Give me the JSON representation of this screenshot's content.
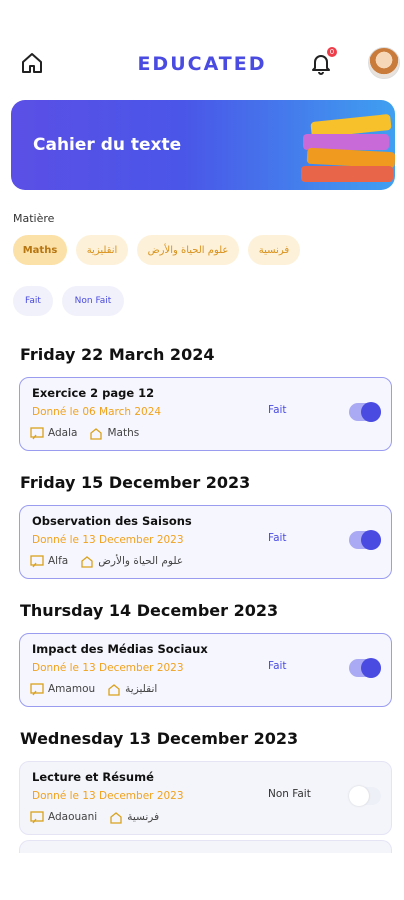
{
  "app": {
    "logo": "EDUCATED",
    "notification_count": "0"
  },
  "banner": {
    "title": "Cahier du texte"
  },
  "filters": {
    "subject_label": "Matière",
    "subjects": [
      "Maths",
      "انقليزية",
      "علوم الحياة والأرض",
      "فرنسية"
    ],
    "selected_subject": "Maths",
    "status": [
      "Fait",
      "Non Fait"
    ]
  },
  "sections": [
    {
      "date": "Friday 22 March 2024",
      "item": {
        "title": "Exercice 2 page 12",
        "given": "Donné le 06 March 2024",
        "teacher": "Adala",
        "subject": "Maths",
        "status": "Fait",
        "done": true
      }
    },
    {
      "date": "Friday 15 December 2023",
      "item": {
        "title": "Observation des Saisons",
        "given": "Donné le 13 December 2023",
        "teacher": "Alfa",
        "subject": "علوم الحياة والأرض",
        "status": "Fait",
        "done": true
      }
    },
    {
      "date": "Thursday 14 December 2023",
      "item": {
        "title": "Impact des Médias Sociaux",
        "given": "Donné le 13 December 2023",
        "teacher": "Amamou",
        "subject": "انقليزية",
        "status": "Fait",
        "done": true
      }
    },
    {
      "date": "Wednesday 13 December 2023",
      "item": {
        "title": "Lecture et Résumé",
        "given": "Donné le 13 December 2023",
        "teacher": "Adaouani",
        "subject": "فرنسية",
        "status": "Non Fait",
        "done": false
      }
    }
  ],
  "colors": {
    "accent": "#4a4be0",
    "chip_bg": "#fdf1d9",
    "date_orange": "#f0a21c"
  }
}
